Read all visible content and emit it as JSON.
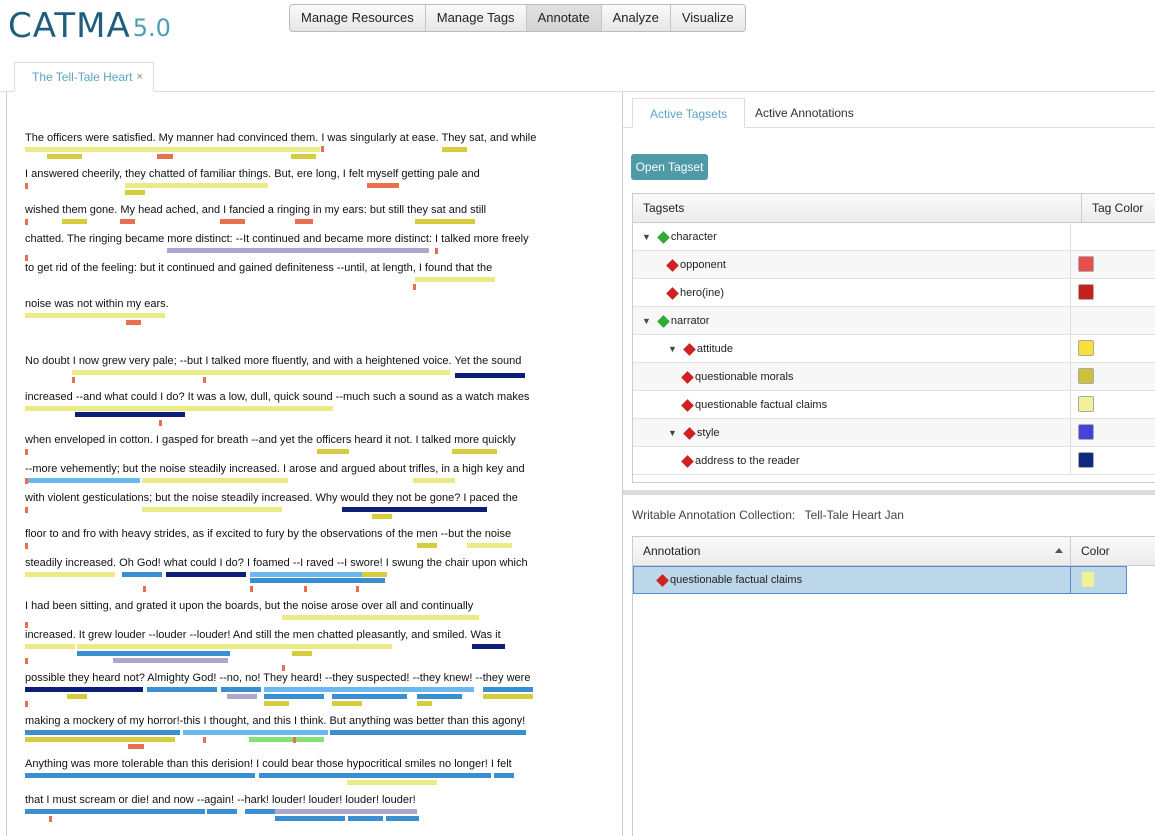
{
  "app": {
    "logo_text": "CATMA",
    "logo_version": "5.0"
  },
  "nav": {
    "items": [
      "Manage Resources",
      "Manage Tags",
      "Annotate",
      "Analyze",
      "Visualize"
    ],
    "active": "Annotate"
  },
  "document_tab": {
    "title": "The Tell-Tale Heart",
    "close": "×"
  },
  "text": {
    "lines": [
      "The officers were satisfied. My manner had convinced them. I was singularly at ease. They sat, and while",
      "I answered cheerily, they chatted of familiar things. But, ere long, I felt myself getting pale and",
      "wished them gone. My head ached, and I fancied a ringing in my ears: but still they sat and still",
      "chatted. The ringing became more distinct: --It continued and became more distinct: I talked more freely",
      "to get rid of the feeling: but it continued and gained definiteness --until, at length, I found that the",
      "noise was not within my ears.",
      "No doubt I now grew very pale; --but I talked more fluently, and with a heightened voice. Yet the sound",
      "increased --and what could I do? It was a low, dull, quick sound --much such a sound as a watch makes",
      "when enveloped in cotton. I gasped for breath --and yet the officers heard it not. I talked more quickly",
      "--more vehemently; but the noise steadily increased. I arose and argued about trifles, in a high key and",
      "with violent gesticulations; but the noise steadily increased. Why would they not be gone? I paced the",
      "floor to and fro with heavy strides, as if excited to fury by the observations of the men --but the noise",
      " steadily increased. Oh God! what could I do? I foamed --I raved --I swore! I swung the chair upon which",
      "I had been sitting, and grated it upon the boards, but the noise arose over all and continually",
      "increased. It grew louder --louder --louder! And still the men chatted pleasantly, and smiled. Was it",
      "possible they heard not? Almighty God! --no, no! They heard! --they suspected! --they knew! --they were",
      "making a mockery of my horror!-this I thought, and this I think. But anything was better than this agony!",
      " Anything was more tolerable than this derision! I could bear those hypocritical smiles no longer! I felt",
      " that I must scream or die! and now --again! --hark! louder! louder! louder! louder!"
    ]
  },
  "right_tabs": {
    "items": [
      "Active Tagsets",
      "Active Annotations"
    ],
    "active": "Active Tagsets"
  },
  "open_tagset": {
    "label": "Open Tagset"
  },
  "tagsets": {
    "header": {
      "name": "Tagsets",
      "color": "Tag Color"
    },
    "rows": [
      {
        "label": "character",
        "expanded": true,
        "level": 0,
        "icon": "green",
        "color": ""
      },
      {
        "label": "opponent",
        "level": 1,
        "icon": "red",
        "color": "#e84e4e"
      },
      {
        "label": "hero(ine)",
        "level": 1,
        "icon": "red",
        "color": "#c8201e"
      },
      {
        "label": "narrator",
        "expanded": true,
        "level": 0,
        "icon": "green",
        "color": ""
      },
      {
        "label": "attitude",
        "expanded": true,
        "level": 1,
        "icon": "red",
        "color": "#f7e13a"
      },
      {
        "label": "questionable morals",
        "level": 2,
        "icon": "red",
        "color": "#cfc03a"
      },
      {
        "label": "questionable factual claims",
        "level": 2,
        "icon": "red",
        "color": "#f3f09a"
      },
      {
        "label": "style",
        "expanded": true,
        "level": 1,
        "icon": "red",
        "color": "#4343d8"
      },
      {
        "label": "address to the reader",
        "level": 2,
        "icon": "red",
        "color": "#0d2a80"
      }
    ]
  },
  "collection": {
    "label": "Writable Annotation Collection:",
    "name": "Tell-Tale Heart Jan"
  },
  "annotations": {
    "header": {
      "name": "Annotation",
      "color": "Color"
    },
    "rows": [
      {
        "label": "questionable factual claims",
        "color": "#f3f09a",
        "selected": true
      }
    ]
  },
  "colors": {
    "yellow": "#ecea84",
    "mustard": "#d6cc3e",
    "salmon": "#e8704e",
    "lavender": "#a8a8d0",
    "navy": "#0d1e78",
    "blue": "#3a8fd0",
    "lightblue": "#6bb8ec",
    "green": "#86e07a"
  }
}
